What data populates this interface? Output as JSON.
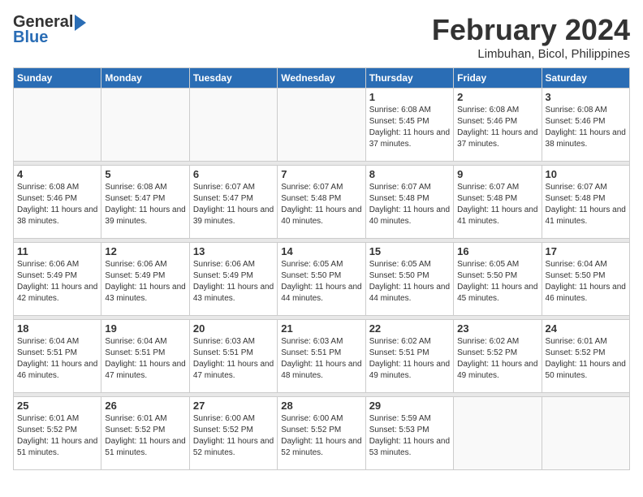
{
  "header": {
    "logo_general": "General",
    "logo_blue": "Blue",
    "month_title": "February 2024",
    "location": "Limbuhan, Bicol, Philippines"
  },
  "weekdays": [
    "Sunday",
    "Monday",
    "Tuesday",
    "Wednesday",
    "Thursday",
    "Friday",
    "Saturday"
  ],
  "weeks": [
    [
      {
        "day": "",
        "info": ""
      },
      {
        "day": "",
        "info": ""
      },
      {
        "day": "",
        "info": ""
      },
      {
        "day": "",
        "info": ""
      },
      {
        "day": "1",
        "info": "Sunrise: 6:08 AM\nSunset: 5:45 PM\nDaylight: 11 hours and 37 minutes."
      },
      {
        "day": "2",
        "info": "Sunrise: 6:08 AM\nSunset: 5:46 PM\nDaylight: 11 hours and 37 minutes."
      },
      {
        "day": "3",
        "info": "Sunrise: 6:08 AM\nSunset: 5:46 PM\nDaylight: 11 hours and 38 minutes."
      }
    ],
    [
      {
        "day": "4",
        "info": "Sunrise: 6:08 AM\nSunset: 5:46 PM\nDaylight: 11 hours and 38 minutes."
      },
      {
        "day": "5",
        "info": "Sunrise: 6:08 AM\nSunset: 5:47 PM\nDaylight: 11 hours and 39 minutes."
      },
      {
        "day": "6",
        "info": "Sunrise: 6:07 AM\nSunset: 5:47 PM\nDaylight: 11 hours and 39 minutes."
      },
      {
        "day": "7",
        "info": "Sunrise: 6:07 AM\nSunset: 5:48 PM\nDaylight: 11 hours and 40 minutes."
      },
      {
        "day": "8",
        "info": "Sunrise: 6:07 AM\nSunset: 5:48 PM\nDaylight: 11 hours and 40 minutes."
      },
      {
        "day": "9",
        "info": "Sunrise: 6:07 AM\nSunset: 5:48 PM\nDaylight: 11 hours and 41 minutes."
      },
      {
        "day": "10",
        "info": "Sunrise: 6:07 AM\nSunset: 5:48 PM\nDaylight: 11 hours and 41 minutes."
      }
    ],
    [
      {
        "day": "11",
        "info": "Sunrise: 6:06 AM\nSunset: 5:49 PM\nDaylight: 11 hours and 42 minutes."
      },
      {
        "day": "12",
        "info": "Sunrise: 6:06 AM\nSunset: 5:49 PM\nDaylight: 11 hours and 43 minutes."
      },
      {
        "day": "13",
        "info": "Sunrise: 6:06 AM\nSunset: 5:49 PM\nDaylight: 11 hours and 43 minutes."
      },
      {
        "day": "14",
        "info": "Sunrise: 6:05 AM\nSunset: 5:50 PM\nDaylight: 11 hours and 44 minutes."
      },
      {
        "day": "15",
        "info": "Sunrise: 6:05 AM\nSunset: 5:50 PM\nDaylight: 11 hours and 44 minutes."
      },
      {
        "day": "16",
        "info": "Sunrise: 6:05 AM\nSunset: 5:50 PM\nDaylight: 11 hours and 45 minutes."
      },
      {
        "day": "17",
        "info": "Sunrise: 6:04 AM\nSunset: 5:50 PM\nDaylight: 11 hours and 46 minutes."
      }
    ],
    [
      {
        "day": "18",
        "info": "Sunrise: 6:04 AM\nSunset: 5:51 PM\nDaylight: 11 hours and 46 minutes."
      },
      {
        "day": "19",
        "info": "Sunrise: 6:04 AM\nSunset: 5:51 PM\nDaylight: 11 hours and 47 minutes."
      },
      {
        "day": "20",
        "info": "Sunrise: 6:03 AM\nSunset: 5:51 PM\nDaylight: 11 hours and 47 minutes."
      },
      {
        "day": "21",
        "info": "Sunrise: 6:03 AM\nSunset: 5:51 PM\nDaylight: 11 hours and 48 minutes."
      },
      {
        "day": "22",
        "info": "Sunrise: 6:02 AM\nSunset: 5:51 PM\nDaylight: 11 hours and 49 minutes."
      },
      {
        "day": "23",
        "info": "Sunrise: 6:02 AM\nSunset: 5:52 PM\nDaylight: 11 hours and 49 minutes."
      },
      {
        "day": "24",
        "info": "Sunrise: 6:01 AM\nSunset: 5:52 PM\nDaylight: 11 hours and 50 minutes."
      }
    ],
    [
      {
        "day": "25",
        "info": "Sunrise: 6:01 AM\nSunset: 5:52 PM\nDaylight: 11 hours and 51 minutes."
      },
      {
        "day": "26",
        "info": "Sunrise: 6:01 AM\nSunset: 5:52 PM\nDaylight: 11 hours and 51 minutes."
      },
      {
        "day": "27",
        "info": "Sunrise: 6:00 AM\nSunset: 5:52 PM\nDaylight: 11 hours and 52 minutes."
      },
      {
        "day": "28",
        "info": "Sunrise: 6:00 AM\nSunset: 5:52 PM\nDaylight: 11 hours and 52 minutes."
      },
      {
        "day": "29",
        "info": "Sunrise: 5:59 AM\nSunset: 5:53 PM\nDaylight: 11 hours and 53 minutes."
      },
      {
        "day": "",
        "info": ""
      },
      {
        "day": "",
        "info": ""
      }
    ]
  ]
}
